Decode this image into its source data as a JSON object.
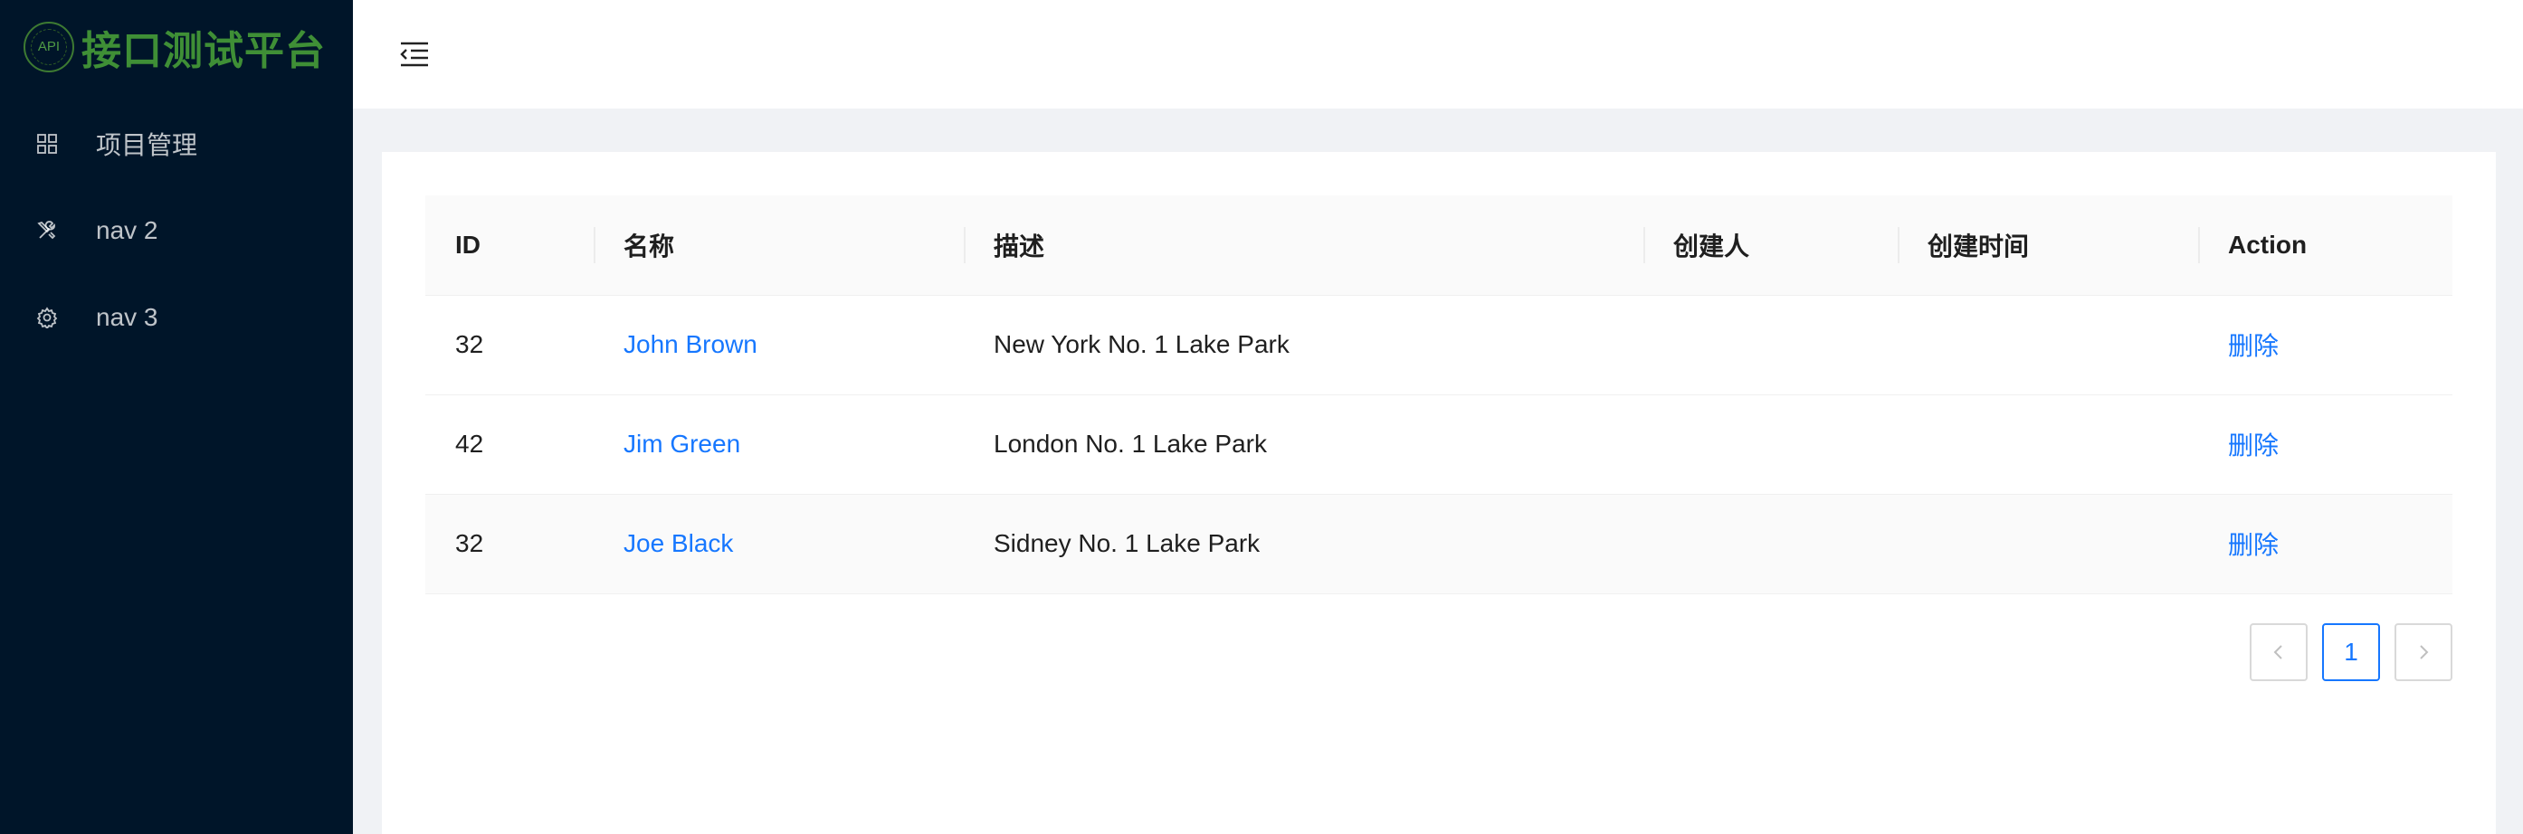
{
  "brand": {
    "badge_text": "API",
    "title": "接口测试平台",
    "color": "#3f8f36"
  },
  "sidebar": {
    "items": [
      {
        "label": "项目管理",
        "icon": "appstore-icon"
      },
      {
        "label": "nav 2",
        "icon": "tools-icon"
      },
      {
        "label": "nav 3",
        "icon": "setting-icon"
      }
    ]
  },
  "header": {
    "fold_icon": "menu-fold-icon"
  },
  "table": {
    "columns": [
      "ID",
      "名称",
      "描述",
      "创建人",
      "创建时间",
      "Action"
    ],
    "rows": [
      {
        "id": "32",
        "name": "John Brown",
        "desc": "New York No. 1 Lake Park",
        "creator": "",
        "created_at": "",
        "action": "删除"
      },
      {
        "id": "42",
        "name": "Jim Green",
        "desc": "London No. 1 Lake Park",
        "creator": "",
        "created_at": "",
        "action": "删除"
      },
      {
        "id": "32",
        "name": "Joe Black",
        "desc": "Sidney No. 1 Lake Park",
        "creator": "",
        "created_at": "",
        "action": "删除"
      }
    ]
  },
  "pagination": {
    "prev": "<",
    "current": "1",
    "next": ">"
  },
  "colors": {
    "sider_bg": "#001529",
    "link": "#1677ff"
  }
}
